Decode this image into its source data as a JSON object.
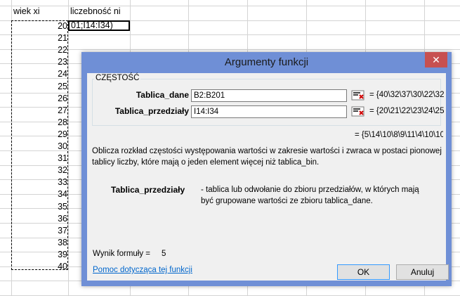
{
  "sheet": {
    "header_col_a": "wiek xi",
    "header_col_b": "liczebność ni",
    "ages": [
      "20",
      "21",
      "22",
      "23",
      "24",
      "25",
      "26",
      "27",
      "28",
      "29",
      "30",
      "31",
      "32",
      "33",
      "34",
      "35",
      "36",
      "37",
      "38",
      "39",
      "40"
    ],
    "editing_cell": "01;I14:I34)"
  },
  "dialog": {
    "title": "Argumenty funkcji",
    "close_label": "✕",
    "function_name": "CZĘSTOŚĆ",
    "args": [
      {
        "label": "Tablica_dane",
        "value": "B2:B201",
        "result": "= {40\\32\\37\\30\\22\\32"
      },
      {
        "label": "Tablica_przedziały",
        "value": "I14:I34",
        "result": "= {20\\21\\22\\23\\24\\25"
      }
    ],
    "overall_result": "= {5\\14\\10\\8\\9\\11\\4\\10\\10",
    "description": "Oblicza rozkład częstości występowania wartości w zakresie wartości i zwraca w postaci pionowej tablicy liczby, które mają o jeden element więcej niż tablica_bin.",
    "arg_help_name": "Tablica_przedziały",
    "arg_help_text": "- tablica lub odwołanie do zbioru przedziałów, w których mają być grupowane wartości ze zbioru tablica_dane.",
    "formula_result_label": "Wynik formuły =",
    "formula_result_value": "5",
    "help_link": "Pomoc dotycząca tej funkcji",
    "ok_label": "OK",
    "cancel_label": "Anuluj"
  }
}
